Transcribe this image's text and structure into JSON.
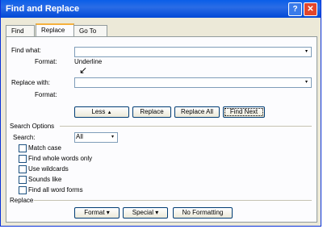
{
  "window": {
    "title": "Find and Replace",
    "help_glyph": "?",
    "close_glyph": "✕"
  },
  "tabs": [
    {
      "label": "Find"
    },
    {
      "label": "Replace"
    },
    {
      "label": "Go To"
    }
  ],
  "find": {
    "label": "Find what:",
    "value": "",
    "format_label": "Format:",
    "format_value": "Underline"
  },
  "replace": {
    "label": "Replace with:",
    "value": "",
    "format_label": "Format:",
    "format_value": ""
  },
  "annotation_arrow": "↙",
  "buttons": {
    "less": "Less",
    "less_glyph": "▲",
    "replace": "Replace",
    "replace_all": "Replace All",
    "find_next": "Find Next"
  },
  "search_options": {
    "heading": "Search Options",
    "search_label": "Search:",
    "search_value": "All",
    "checkboxes": [
      {
        "label": "Match case",
        "checked": false
      },
      {
        "label": "Find whole words only",
        "checked": false
      },
      {
        "label": "Use wildcards",
        "checked": false
      },
      {
        "label": "Sounds like",
        "checked": false
      },
      {
        "label": "Find all word forms",
        "checked": false
      }
    ]
  },
  "replace_section": {
    "heading": "Replace",
    "format_button": "Format",
    "special_button": "Special",
    "no_formatting_button": "No Formatting",
    "dropdown_glyph": "▾"
  }
}
